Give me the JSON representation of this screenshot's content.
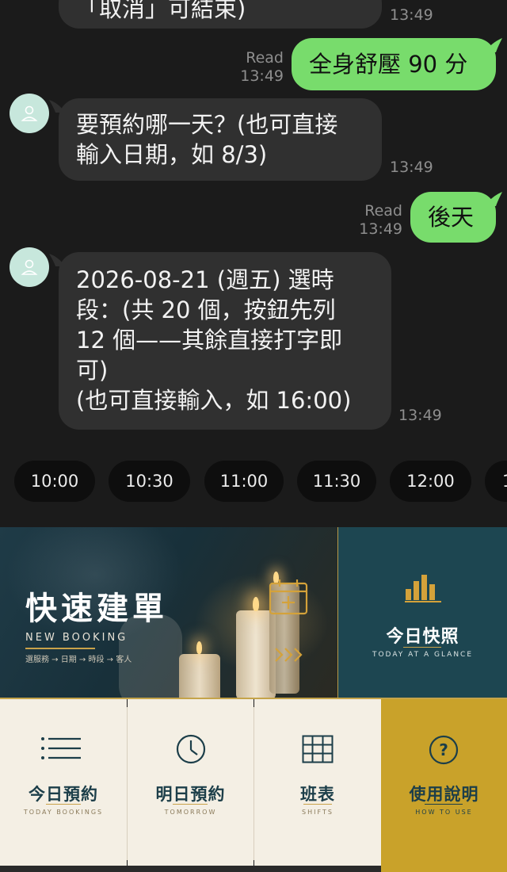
{
  "chat": {
    "top_partial_text": "「取消」可結束)",
    "top_time": "13:49",
    "messages": [
      {
        "from": "user",
        "status": "Read",
        "time": "13:49",
        "text": "全身舒壓 90 分"
      },
      {
        "from": "bot",
        "time": "13:49",
        "lines": [
          "要預約哪一天？(也可直接",
          "輸入日期，如 8/3)"
        ]
      },
      {
        "from": "user",
        "status": "Read",
        "time": "13:49",
        "text": "後天"
      },
      {
        "from": "bot",
        "time": "13:49",
        "lines": [
          "2026-08-21 (週五) 選時",
          "段：(共 20 個，按鈕先列",
          "12 個——其餘直接打字即",
          "可)",
          "(也可直接輸入，如 16:00)"
        ]
      }
    ],
    "quick_replies": [
      "10:00",
      "10:30",
      "11:00",
      "11:30",
      "12:00",
      "1"
    ]
  },
  "rich_menu": {
    "new_booking": {
      "title": "快速建單",
      "subtitle": "NEW BOOKING",
      "steps": "選服務 → 日期 → 時段 → 客人"
    },
    "today_glance": {
      "title": "今日快照",
      "subtitle": "TODAY AT A GLANCE"
    },
    "tiles": [
      {
        "title": "今日預約",
        "subtitle": "TODAY BOOKINGS",
        "icon": "list-icon"
      },
      {
        "title": "明日預約",
        "subtitle": "TOMORROW",
        "icon": "clock-icon"
      },
      {
        "title": "班表",
        "subtitle": "SHIFTS",
        "icon": "grid-icon"
      },
      {
        "title": "使用說明",
        "subtitle": "HOW TO USE",
        "icon": "question-icon"
      }
    ]
  },
  "colors": {
    "chat_bg": "#1b1b1b",
    "incoming_bubble": "#303030",
    "outgoing_bubble": "#78dc6c",
    "teal": "#1d4651",
    "gold": "#c9a22a",
    "cream": "#f4efe4"
  }
}
